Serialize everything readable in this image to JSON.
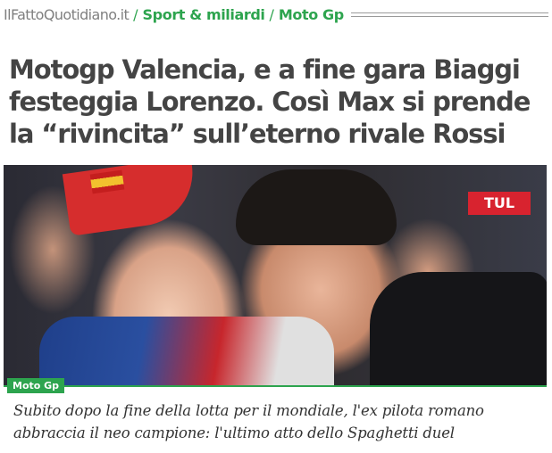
{
  "breadcrumb": {
    "site": "IlFattoQuotidiano.it",
    "separator": "/",
    "section": "Sport & miliardi",
    "subsection": "Moto Gp"
  },
  "article": {
    "headline": "Motogp Valencia, e a fine gara Biaggi festeggia Lorenzo. Così Max si prende la “rivincita” sull’eterno rivale Rossi",
    "category_badge": "Moto Gp",
    "subtitle": "Subito dopo la fine della lotta per il mondiale, l'ex pilota romano abbraccia il neo campione: l'ultimo atto dello Spaghetti duel",
    "photo_sign_text": "TUL"
  },
  "colors": {
    "accent": "#2da44e",
    "headline": "#444444",
    "site_name": "#808080"
  }
}
